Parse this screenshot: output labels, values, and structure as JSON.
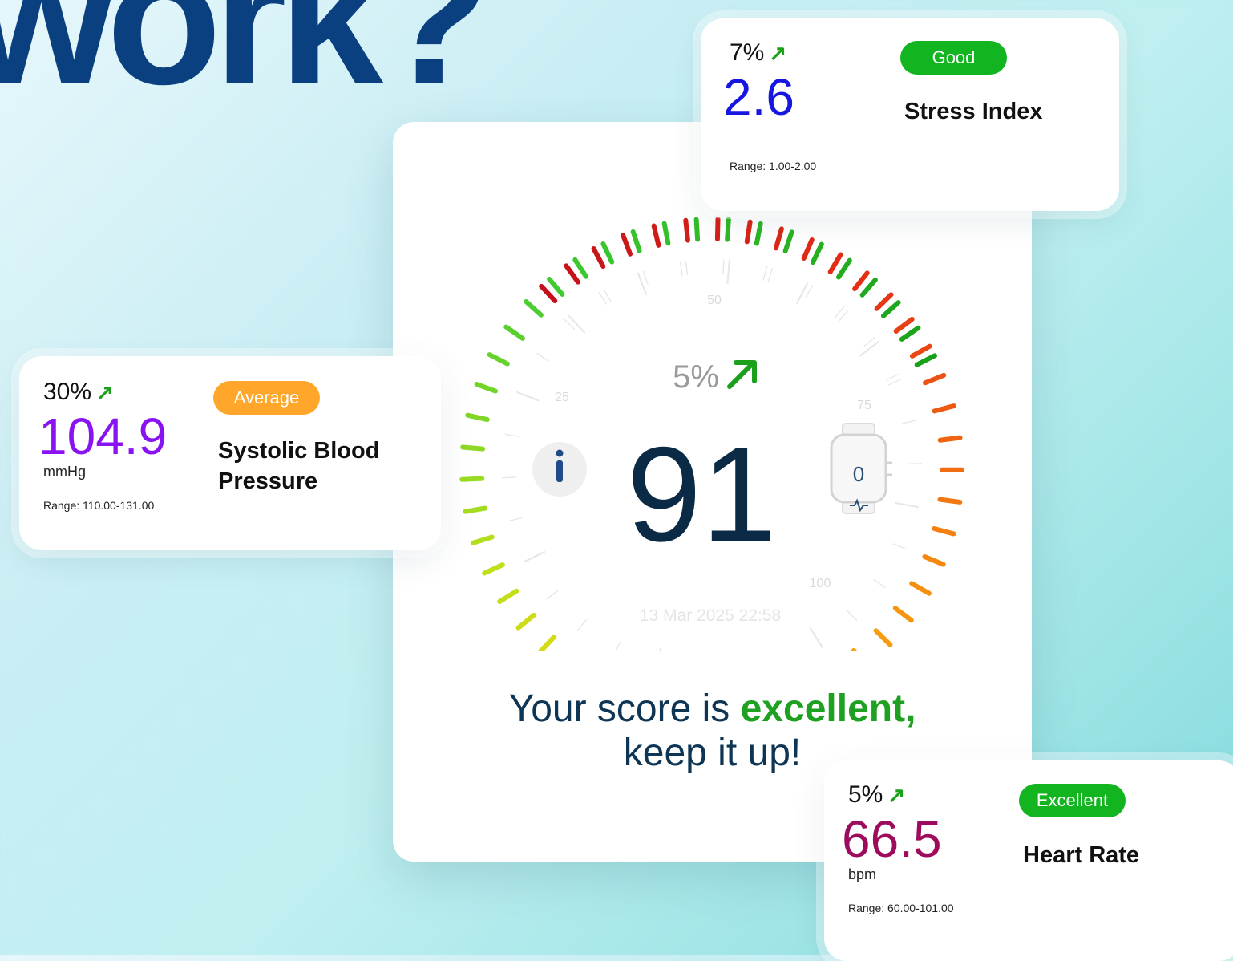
{
  "headline": "work?",
  "main_card": {
    "gauge": {
      "score": "91",
      "change": "5%",
      "ticks": [
        "25",
        "50",
        "75",
        "100"
      ],
      "device_value": "0",
      "timestamp": "13 Mar 2025 22:58"
    },
    "message_prefix": "Your score is ",
    "message_highlight": "excellent,",
    "message_suffix": "keep it up!"
  },
  "metrics": {
    "stress": {
      "change": "7%",
      "value": "2.6",
      "unit": "",
      "range": "Range: 1.00-2.00",
      "badge": "Good",
      "title": "Stress Index",
      "value_color": "#1616e0",
      "badge_color": "#12b520"
    },
    "blood_pressure": {
      "change": "30%",
      "value": "104.9",
      "unit": "mmHg",
      "range": "Range: 110.00-131.00",
      "badge": "Average",
      "title_line1": "Systolic Blood",
      "title_line2": "Pressure",
      "value_color": "#8a13f2",
      "badge_color": "#ffa62b"
    },
    "heart_rate": {
      "change": "5%",
      "value": "66.5",
      "unit": "bpm",
      "range": "Range: 60.00-101.00",
      "badge": "Excellent",
      "title": "Heart Rate",
      "value_color": "#9c0b5c",
      "badge_color": "#12b520"
    }
  },
  "icons": {
    "trend": "arrow-up-right-icon",
    "info": "info-icon",
    "device": "smartwatch-icon"
  }
}
